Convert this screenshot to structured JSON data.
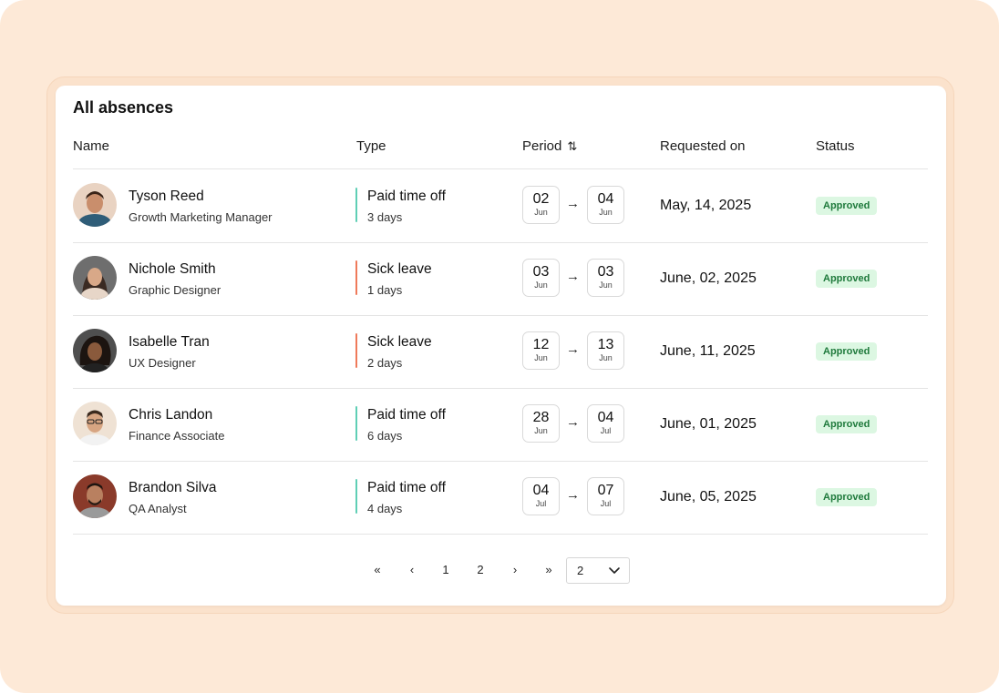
{
  "card": {
    "title": "All absences"
  },
  "columns": {
    "name": "Name",
    "type": "Type",
    "period": "Period",
    "requested": "Requested on",
    "status": "Status",
    "period_sort_icon": "sort-arrows-icon"
  },
  "colors": {
    "paid_time_off": "#5fcfb5",
    "sick_leave": "#ef7a5a",
    "approved_bg": "#dcf7e2",
    "approved_text": "#1f7a3c",
    "page_bg": "#fde9d7"
  },
  "rows": [
    {
      "name": "Tyson Reed",
      "role": "Growth Marketing Manager",
      "type": "Paid time off",
      "days": "3 days",
      "from_day": "02",
      "from_month": "Jun",
      "to_day": "04",
      "to_month": "Jun",
      "requested": "May, 14, 2025",
      "status": "Approved"
    },
    {
      "name": "Nichole Smith",
      "role": "Graphic Designer",
      "type": "Sick leave",
      "days": "1 days",
      "from_day": "03",
      "from_month": "Jun",
      "to_day": "03",
      "to_month": "Jun",
      "requested": "June, 02, 2025",
      "status": "Approved"
    },
    {
      "name": "Isabelle Tran",
      "role": "UX Designer",
      "type": "Sick leave",
      "days": "2 days",
      "from_day": "12",
      "from_month": "Jun",
      "to_day": "13",
      "to_month": "Jun",
      "requested": "June, 11, 2025",
      "status": "Approved"
    },
    {
      "name": "Chris Landon",
      "role": "Finance Associate",
      "type": "Paid time off",
      "days": "6 days",
      "from_day": "28",
      "from_month": "Jun",
      "to_day": "04",
      "to_month": "Jul",
      "requested": "June, 01, 2025",
      "status": "Approved"
    },
    {
      "name": "Brandon Silva",
      "role": "QA Analyst",
      "type": "Paid time off",
      "days": "4 days",
      "from_day": "04",
      "from_month": "Jul",
      "to_day": "07",
      "to_month": "Jul",
      "requested": "June, 05, 2025",
      "status": "Approved"
    }
  ],
  "pagination": {
    "first": "«",
    "prev": "‹",
    "pages": [
      "1",
      "2"
    ],
    "next": "›",
    "last": "»",
    "per_page_value": "2"
  }
}
